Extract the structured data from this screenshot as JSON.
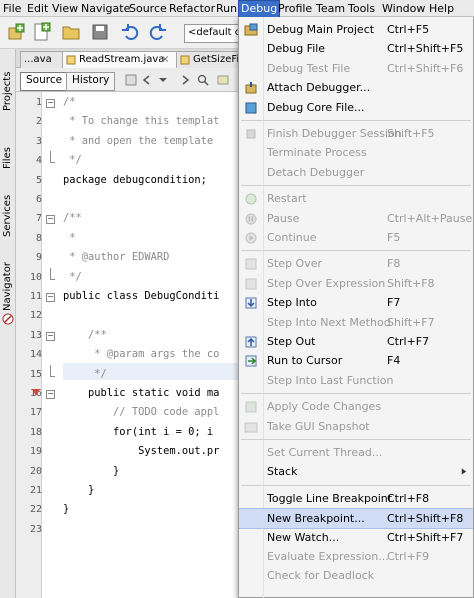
{
  "menubar": {
    "items": [
      "File",
      "Edit",
      "View",
      "Navigate",
      "Source",
      "Refactor",
      "Run",
      "Debug",
      "Profile",
      "Team",
      "Tools",
      "Window",
      "Help"
    ]
  },
  "toolbar": {
    "config_combo": "<default co"
  },
  "side_tabs": [
    "Projects",
    "Files",
    "Services",
    "Navigator"
  ],
  "file_tabs": [
    "...ava",
    "ReadStream.java",
    "GetSizeFile"
  ],
  "editor_bar": {
    "source_label": "Source",
    "history_label": "History"
  },
  "code": {
    "lines": [
      {
        "n": "1",
        "t": "/*",
        "cls": "cmt"
      },
      {
        "n": "2",
        "t": " * To change this templat",
        "cls": "cmt"
      },
      {
        "n": "3",
        "t": " * and open the template",
        "cls": "cmt"
      },
      {
        "n": "4",
        "t": " */",
        "cls": "cmt"
      },
      {
        "n": "5",
        "t": "package debugcondition;",
        "cls": ""
      },
      {
        "n": "6",
        "t": "",
        "cls": ""
      },
      {
        "n": "7",
        "t": "/**",
        "cls": "cmt"
      },
      {
        "n": "8",
        "t": " *",
        "cls": "cmt"
      },
      {
        "n": "9",
        "t": " * @author EDWARD",
        "cls": "cmt"
      },
      {
        "n": "10",
        "t": " */",
        "cls": "cmt"
      },
      {
        "n": "11",
        "t": "public class DebugConditi",
        "cls": ""
      },
      {
        "n": "12",
        "t": "",
        "cls": ""
      },
      {
        "n": "13",
        "t": "    /**",
        "cls": "cmt"
      },
      {
        "n": "14",
        "t": "     * @param args the co",
        "cls": "cmt"
      },
      {
        "n": "15",
        "t": "     */",
        "cls": "cmt"
      },
      {
        "n": "16",
        "t": "    public static void ma",
        "cls": ""
      },
      {
        "n": "17",
        "t": "        // TODO code appl",
        "cls": "cmt"
      },
      {
        "n": "18",
        "t": "        for(int i = 0; i",
        "cls": ""
      },
      {
        "n": "19",
        "t": "            System.out.pr",
        "cls": ""
      },
      {
        "n": "20",
        "t": "        }",
        "cls": ""
      },
      {
        "n": "21",
        "t": "    }",
        "cls": ""
      },
      {
        "n": "22",
        "t": "}",
        "cls": ""
      },
      {
        "n": "23",
        "t": "",
        "cls": ""
      }
    ]
  },
  "debug_menu": {
    "items": [
      {
        "label": "Debug Main Project",
        "u": "D",
        "accel": "Ctrl+F5",
        "enabled": true,
        "icon": "debug-project-icon"
      },
      {
        "label": "Debug File",
        "accel": "Ctrl+Shift+F5",
        "enabled": true,
        "icon": ""
      },
      {
        "label": "Debug Test File",
        "accel": "Ctrl+Shift+F6",
        "enabled": false,
        "icon": ""
      },
      {
        "label": "Attach Debugger...",
        "accel": "",
        "enabled": true,
        "icon": "attach-debugger-icon"
      },
      {
        "label": "Debug Core File...",
        "accel": "",
        "enabled": true,
        "icon": "debug-core-icon"
      },
      {
        "sep": true
      },
      {
        "label": "Finish Debugger Session",
        "accel": "Shift+F5",
        "enabled": false,
        "icon": "finish-session-icon"
      },
      {
        "label": "Terminate Process",
        "accel": "",
        "enabled": false,
        "icon": ""
      },
      {
        "label": "Detach Debugger",
        "accel": "",
        "enabled": false,
        "icon": ""
      },
      {
        "sep": true
      },
      {
        "label": "Restart",
        "accel": "",
        "enabled": false,
        "icon": "restart-icon"
      },
      {
        "label": "Pause",
        "accel": "Ctrl+Alt+Pause",
        "enabled": false,
        "icon": "pause-icon"
      },
      {
        "label": "Continue",
        "accel": "F5",
        "enabled": false,
        "icon": "continue-icon"
      },
      {
        "sep": true
      },
      {
        "label": "Step Over",
        "accel": "F8",
        "enabled": false,
        "icon": "step-over-icon"
      },
      {
        "label": "Step Over Expression",
        "accel": "Shift+F8",
        "enabled": false,
        "icon": "step-over-expression-icon"
      },
      {
        "label": "Step Into",
        "accel": "F7",
        "enabled": true,
        "icon": "step-into-icon"
      },
      {
        "label": "Step Into Next Method",
        "accel": "Shift+F7",
        "enabled": false,
        "icon": ""
      },
      {
        "label": "Step Out",
        "accel": "Ctrl+F7",
        "enabled": true,
        "icon": "step-out-icon"
      },
      {
        "label": "Run to Cursor",
        "accel": "F4",
        "enabled": true,
        "icon": "run-to-cursor-icon"
      },
      {
        "label": "Step Into Last Function",
        "accel": "",
        "enabled": false,
        "icon": ""
      },
      {
        "sep": true
      },
      {
        "label": "Apply Code Changes",
        "accel": "",
        "enabled": false,
        "icon": "apply-code-changes-icon"
      },
      {
        "label": "Take GUI Snapshot",
        "accel": "",
        "enabled": false,
        "icon": "gui-snapshot-icon"
      },
      {
        "sep": true
      },
      {
        "label": "Set Current Thread...",
        "accel": "",
        "enabled": false,
        "icon": ""
      },
      {
        "label": "Stack",
        "accel": "",
        "enabled": true,
        "icon": "",
        "submenu": true
      },
      {
        "sep": true
      },
      {
        "label": "Toggle Line Breakpoint",
        "accel": "Ctrl+F8",
        "enabled": true,
        "icon": ""
      },
      {
        "label": "New Breakpoint...",
        "accel": "Ctrl+Shift+F8",
        "enabled": true,
        "icon": "",
        "selected": true
      },
      {
        "label": "New Watch...",
        "accel": "Ctrl+Shift+F7",
        "enabled": true,
        "icon": ""
      },
      {
        "label": "Evaluate Expression...",
        "accel": "Ctrl+F9",
        "enabled": false,
        "icon": ""
      },
      {
        "label": "Check for Deadlock",
        "accel": "",
        "enabled": false,
        "icon": ""
      }
    ]
  }
}
